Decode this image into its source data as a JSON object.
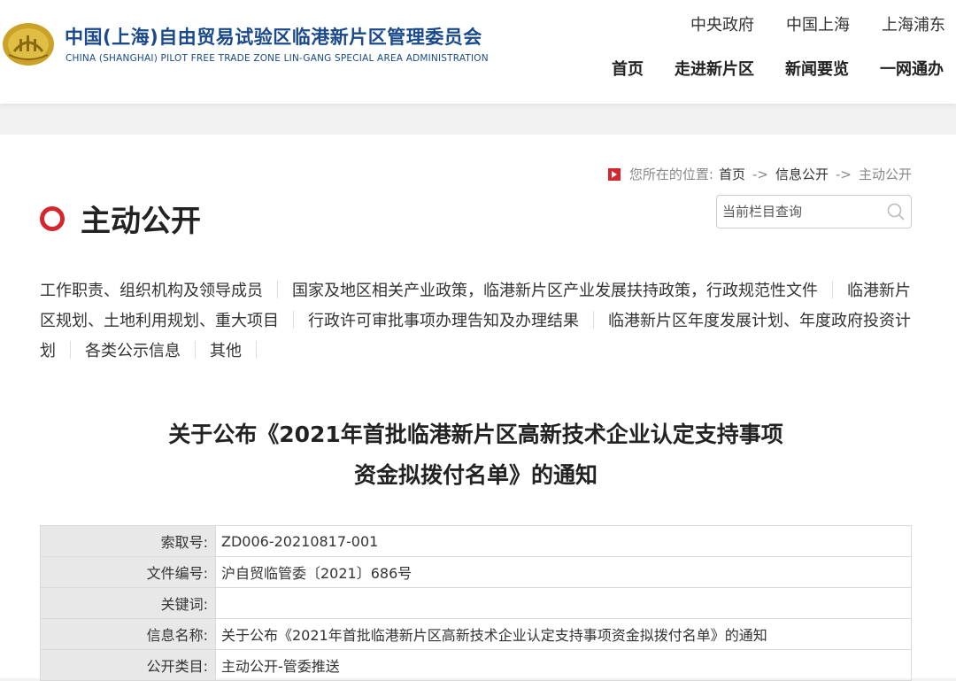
{
  "header": {
    "logo_cn": "中国(上海)自由贸易试验区临港新片区管理委员会",
    "logo_en": "CHINA (SHANGHAI) PILOT FREE TRADE ZONE LIN-GANG SPECIAL AREA ADMINISTRATION",
    "top_links": [
      "中央政府",
      "中国上海",
      "上海浦东"
    ],
    "nav": [
      "首页",
      "走进新片区",
      "新闻要览",
      "一网通办"
    ]
  },
  "breadcrumb": {
    "prefix": "您所在的位置:",
    "items": [
      "首页",
      "信息公开",
      "主动公开"
    ],
    "separator": "->"
  },
  "section": {
    "title": "主动公开"
  },
  "search": {
    "placeholder": "当前栏目查询"
  },
  "categories": [
    "工作职责、组织机构及领导成员",
    "国家及地区相关产业政策，临港新片区产业发展扶持政策，行政规范性文件",
    "临港新片区规划、土地利用规划、重大项目",
    "行政许可审批事项办理告知及办理结果",
    "临港新片区年度发展计划、年度政府投资计划",
    "各类公示信息",
    "其他"
  ],
  "document": {
    "title_line1": "关于公布《2021年首批临港新片区高新技术企业认定支持事项",
    "title_line2": "资金拟拨付名单》的通知"
  },
  "info_rows": [
    {
      "label": "索取号:",
      "value": "ZD006-20210817-001"
    },
    {
      "label": "文件编号:",
      "value": "沪自贸临管委〔2021〕686号"
    },
    {
      "label": "关键词:",
      "value": ""
    },
    {
      "label": "信息名称:",
      "value": "关于公布《2021年首批临港新片区高新技术企业认定支持事项资金拟拨付名单》的通知"
    },
    {
      "label": "公开类目:",
      "value": "主动公开-管委推送"
    }
  ],
  "colors": {
    "brand_blue": "#1a4a8c",
    "accent_red": "#d6262d",
    "logo_gold": "#c9a227"
  }
}
